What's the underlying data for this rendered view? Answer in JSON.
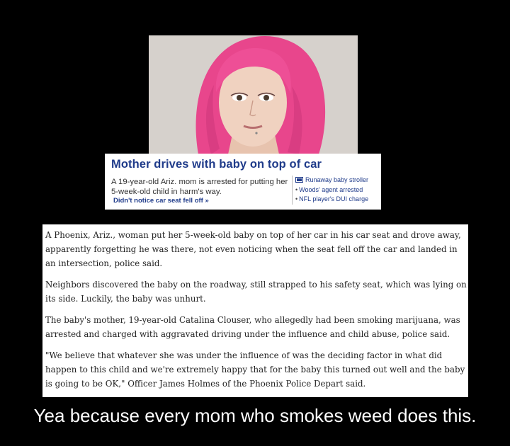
{
  "news_card": {
    "headline": "Mother drives with baby on top of car",
    "summary": "A 19-year-old Ariz. mom is arrested for putting her 5-week-old child in harm's way.",
    "more_link": "Didn't notice car seat fell off »",
    "related_links": [
      {
        "label": "Runaway baby stroller",
        "icon": "stroller-icon"
      },
      {
        "label": "Woods' agent arrested",
        "icon": "bullet"
      },
      {
        "label": "NFL player's DUI charge",
        "icon": "bullet"
      }
    ]
  },
  "article": {
    "paragraphs": [
      "A Phoenix, Ariz., woman put her 5-week-old baby on top of her car in his car seat and drove away, apparently forgetting he was there, not even noticing when the seat fell off the car and landed in an intersection, police said.",
      "Neighbors discovered the baby on the roadway, still strapped to his safety seat, which was lying on its side. Luckily, the baby was unhurt.",
      "The baby's mother, 19-year-old Catalina Clouser, who allegedly had been smoking marijuana, was arrested and charged with aggravated driving under the influence and child abuse, police said.",
      "\"We believe that whatever she was under the influence of was the deciding factor in what did happen to this child and we're extremely happy that for the baby this turned out well and the baby is going to be OK,\" Officer James Holmes of the Phoenix Police Depart said."
    ]
  },
  "caption": "Yea because every mom who smokes weed does this.",
  "colors": {
    "background": "#000000",
    "headline": "#1f3b8a",
    "hair": "#e8468c"
  }
}
